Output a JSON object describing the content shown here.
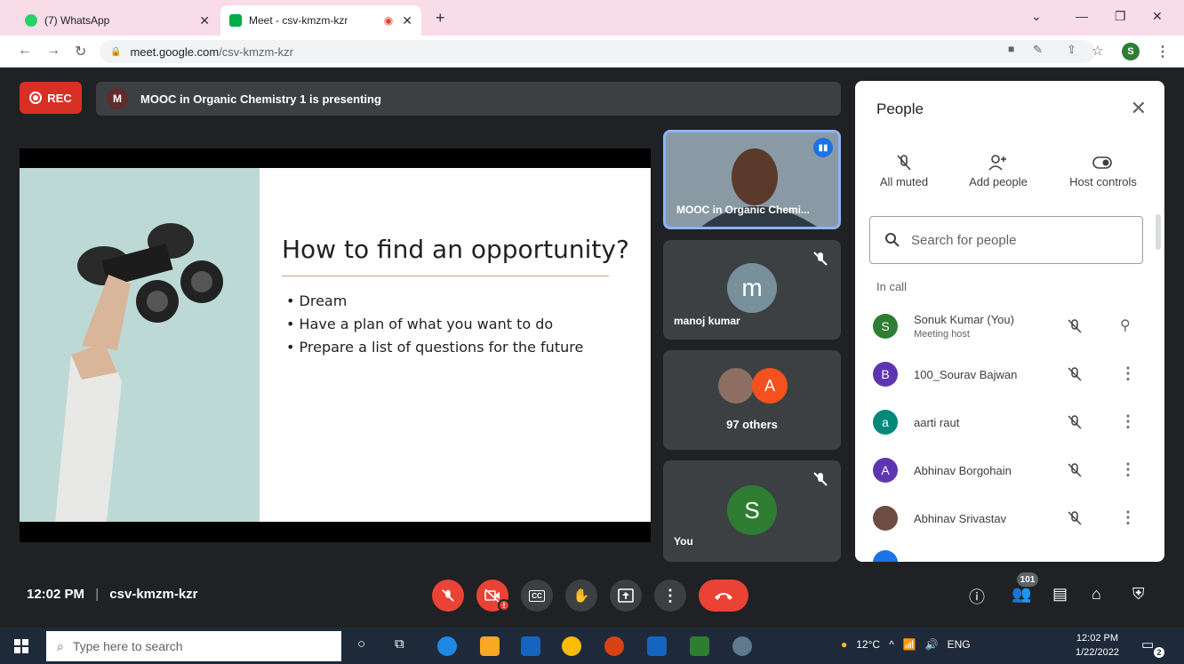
{
  "browser": {
    "tabs": [
      {
        "label": "(7) WhatsApp",
        "icon": "whatsapp-icon"
      },
      {
        "label": "Meet - csv-kmzm-kzr",
        "icon": "meet-icon"
      }
    ],
    "url_host": "meet.google.com",
    "url_path": "/csv-kmzm-kzr"
  },
  "meet": {
    "rec_label": "REC",
    "presenter_initial": "M",
    "presenting_text": "MOOC in Organic Chemistry 1 is presenting",
    "slide": {
      "title": "How to find an opportunity?",
      "bullets": [
        "Dream",
        "Have a plan of what you want to do",
        "Prepare a list of questions for the future"
      ]
    },
    "tiles": {
      "speaker_name": "MOOC in Organic Chemi...",
      "tile2_initial": "m",
      "tile2_name": "manoj kumar",
      "others_initial": "A",
      "others_label": "97 others",
      "you_initial": "S",
      "you_label": "You"
    }
  },
  "people": {
    "title": "People",
    "actions": [
      {
        "label": "All muted",
        "icon": "mic-off-icon"
      },
      {
        "label": "Add people",
        "icon": "add-person-icon"
      },
      {
        "label": "Host controls",
        "icon": "toggle-icon"
      }
    ],
    "search_placeholder": "Search for people",
    "section_label": "In call",
    "participants": [
      {
        "initial": "S",
        "name": "Sonuk Kumar (You)",
        "sub": "Meeting host",
        "color": "#2e7d32"
      },
      {
        "initial": "B",
        "name": "100_Sourav Bajwan",
        "sub": "",
        "color": "#5e35b1"
      },
      {
        "initial": "a",
        "name": "aarti raut",
        "sub": "",
        "color": "#00897b"
      },
      {
        "initial": "A",
        "name": "Abhinav Borgohain",
        "sub": "",
        "color": "#5e35b1"
      },
      {
        "initial": "",
        "name": "Abhinav Srivastav",
        "sub": "",
        "color": "#6d4c41"
      }
    ]
  },
  "bottombar": {
    "time": "12:02 PM",
    "meeting_code": "csv-kmzm-kzr",
    "participant_count": "101"
  },
  "taskbar": {
    "search_placeholder": "Type here to search",
    "temperature": "12°C",
    "language": "ENG",
    "time": "12:02 PM",
    "date": "1/22/2022",
    "notification_count": "2"
  }
}
